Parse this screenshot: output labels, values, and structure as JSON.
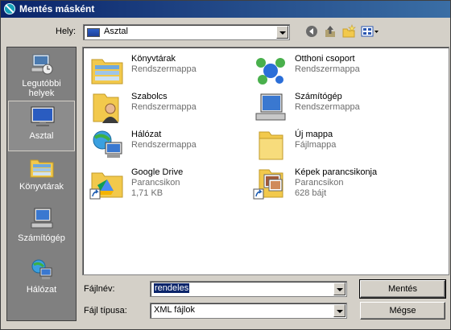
{
  "window": {
    "title": "Mentés másként"
  },
  "location": {
    "label": "Hely:",
    "value": "Asztal"
  },
  "places": [
    {
      "label": "Legutóbbi helyek",
      "icon": "recent-places-icon"
    },
    {
      "label": "Asztal",
      "icon": "desktop-icon",
      "selected": true
    },
    {
      "label": "Könyvtárak",
      "icon": "libraries-icon"
    },
    {
      "label": "Számítógép",
      "icon": "computer-icon"
    },
    {
      "label": "Hálózat",
      "icon": "network-icon"
    }
  ],
  "items": [
    {
      "name": "Könyvtárak",
      "sub": "Rendszermappa",
      "icon": "libraries-folder-icon"
    },
    {
      "name": "Otthoni csoport",
      "sub": "Rendszermappa",
      "icon": "homegroup-icon"
    },
    {
      "name": "Szabolcs",
      "sub": "Rendszermappa",
      "icon": "user-folder-icon"
    },
    {
      "name": "Számítógép",
      "sub": "Rendszermappa",
      "icon": "computer-icon"
    },
    {
      "name": "Hálózat",
      "sub": "Rendszermappa",
      "icon": "network-icon"
    },
    {
      "name": "Új mappa",
      "sub": "Fájlmappa",
      "icon": "folder-icon"
    },
    {
      "name": "Google Drive",
      "sub": "Parancsikon",
      "sub2": "1,71 KB",
      "icon": "google-drive-shortcut-icon"
    },
    {
      "name": "Képek parancsikonja",
      "sub": "Parancsikon",
      "sub2": "628 bájt",
      "icon": "pictures-shortcut-icon"
    }
  ],
  "filename": {
    "label": "Fájlnév:",
    "value": "rendeles"
  },
  "filetype": {
    "label": "Fájl típusa:",
    "value": "XML fájlok"
  },
  "buttons": {
    "save": "Mentés",
    "cancel": "Mégse"
  }
}
